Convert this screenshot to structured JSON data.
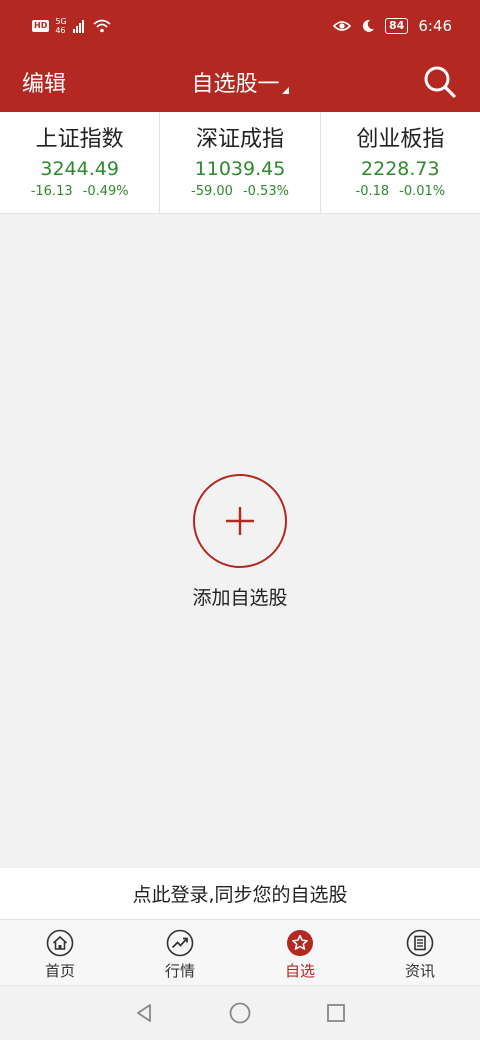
{
  "status_bar": {
    "hd": "HD",
    "network_top": "5G",
    "network_bottom": "46",
    "battery": "84",
    "time": "6:46"
  },
  "header": {
    "edit_label": "编辑",
    "title": "自选股一",
    "icons": {
      "search": "search-icon"
    }
  },
  "indices": [
    {
      "name": "上证指数",
      "value": "3244.49",
      "change": "-16.13",
      "percent": "-0.49%"
    },
    {
      "name": "深证成指",
      "value": "11039.45",
      "change": "-59.00",
      "percent": "-0.53%"
    },
    {
      "name": "创业板指",
      "value": "2228.73",
      "change": "-0.18",
      "percent": "-0.01%"
    }
  ],
  "main": {
    "add_label": "添加自选股"
  },
  "login_banner": "点此登录,同步您的自选股",
  "bottom_nav": [
    {
      "label": "首页",
      "icon": "home-icon"
    },
    {
      "label": "行情",
      "icon": "trend-icon"
    },
    {
      "label": "自选",
      "icon": "star-icon",
      "active": true
    },
    {
      "label": "资讯",
      "icon": "news-icon"
    }
  ],
  "colors": {
    "brand_red": "#b32821",
    "down_green": "#2d8a2d",
    "background": "#f2f2f2"
  }
}
